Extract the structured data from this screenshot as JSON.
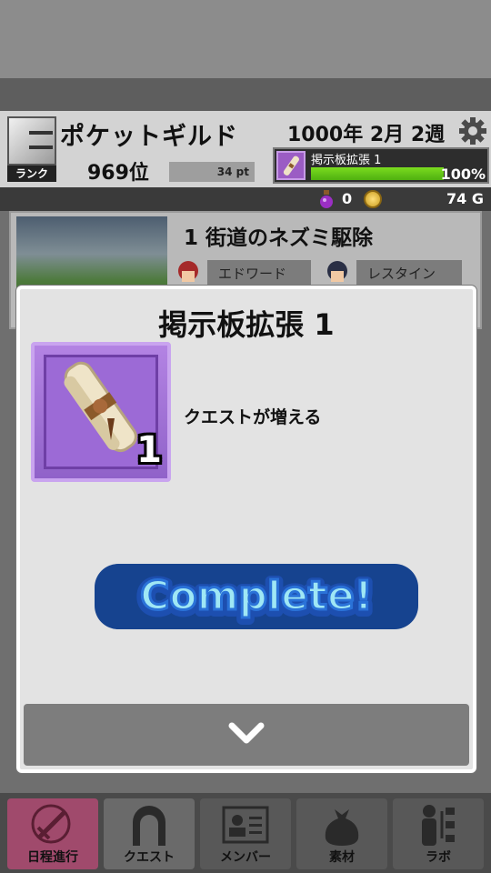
{
  "header": {
    "rank_badge_label": "ランク",
    "guild_name": "ポケットギルド",
    "rank_position": "969位",
    "points": "34 pt",
    "date": "1000年 2月 2週",
    "current_task": {
      "name": "掲示板拡張 1",
      "progress_percent": 100,
      "progress_label": "100%"
    }
  },
  "resources": {
    "potion_count": "0",
    "gold": "74 G"
  },
  "quest_card": {
    "title": "1 街道のネズミ駆除",
    "members": [
      "エドワード",
      "レスタイン"
    ]
  },
  "dialog": {
    "title": "掲示板拡張 1",
    "item_count": "1",
    "item_description": "クエストが増える",
    "banner_text": "Complete!"
  },
  "bottom_nav": {
    "items": [
      {
        "label": "日程進行",
        "icon": "sword-icon"
      },
      {
        "label": "クエスト",
        "icon": "gate-icon"
      },
      {
        "label": "メンバー",
        "icon": "id-card-icon"
      },
      {
        "label": "素材",
        "icon": "bag-icon"
      },
      {
        "label": "ラボ",
        "icon": "lab-icon"
      }
    ]
  },
  "colors": {
    "progress_green": "#7bdc1f",
    "item_frame_purple": "#9c6ad6",
    "banner_blue": "#2a72d8",
    "nav_active": "#a04a6c"
  }
}
